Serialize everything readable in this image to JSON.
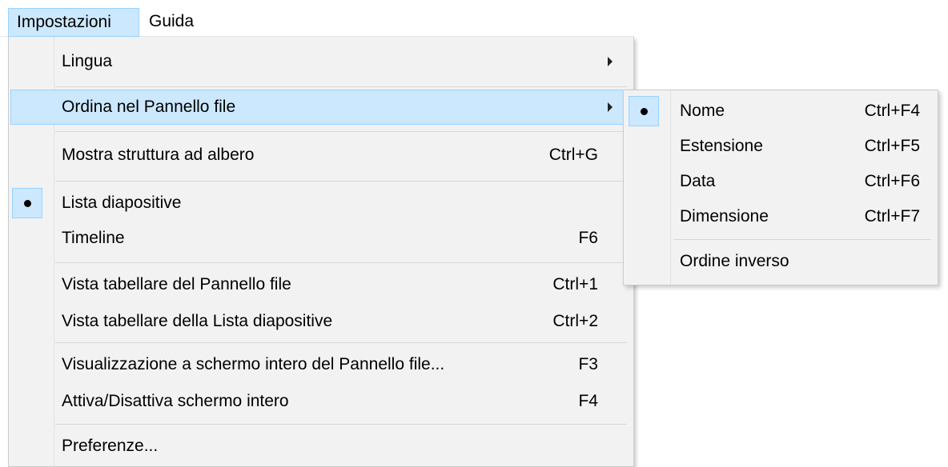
{
  "menubar": {
    "items": [
      {
        "label": "Impostazioni"
      },
      {
        "label": "Guida"
      }
    ]
  },
  "menu": {
    "items": [
      {
        "label": "Lingua",
        "has_submenu": true
      },
      {
        "label": "Ordina nel Pannello file",
        "has_submenu": true
      },
      {
        "label": "Mostra struttura ad albero",
        "shortcut": "Ctrl+G"
      },
      {
        "label": "Lista diapositive",
        "checked": true
      },
      {
        "label": "Timeline",
        "shortcut": "F6"
      },
      {
        "label": "Vista tabellare del Pannello file",
        "shortcut": "Ctrl+1"
      },
      {
        "label": "Vista tabellare della Lista diapositive",
        "shortcut": "Ctrl+2"
      },
      {
        "label": "Visualizzazione a schermo intero del Pannello file...",
        "shortcut": "F3"
      },
      {
        "label": "Attiva/Disattiva schermo intero",
        "shortcut": "F4"
      },
      {
        "label": "Preferenze..."
      }
    ]
  },
  "submenu": {
    "items": [
      {
        "label": "Nome",
        "shortcut": "Ctrl+F4",
        "checked": true
      },
      {
        "label": "Estensione",
        "shortcut": "Ctrl+F5"
      },
      {
        "label": "Data",
        "shortcut": "Ctrl+F6"
      },
      {
        "label": "Dimensione",
        "shortcut": "Ctrl+F7"
      },
      {
        "label": "Ordine inverso"
      }
    ]
  },
  "colors": {
    "highlight": "#cce8ff",
    "highlight_border": "#99d1ff",
    "menu_bg": "#f2f2f2"
  }
}
